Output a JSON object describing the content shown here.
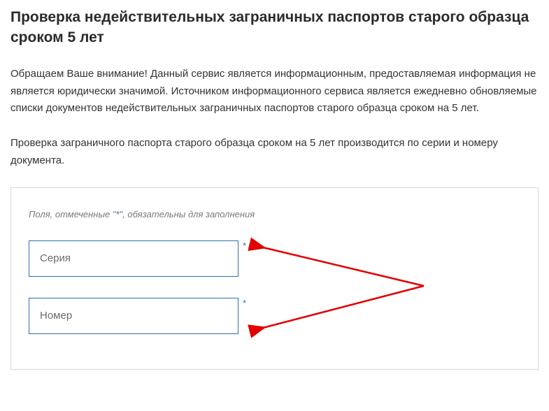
{
  "title": "Проверка недействительных заграничных паспортов старого образца сроком 5 лет",
  "paragraphs": {
    "p1": "Обращаем Ваше внимание! Данный сервис является информационным, предоставляемая информация не является юридически значимой. Источником информационного сервиса является ежедневно обновляемые списки документов недействительных заграничных паспортов старого образца сроком на 5 лет.",
    "p2": "Проверка заграничного паспорта старого образца сроком на 5 лет производится по серии и номеру документа."
  },
  "form": {
    "hint_prefix": "Поля, отмеченные \"",
    "hint_mid": "*",
    "hint_suffix": "\", обязательны для заполнения",
    "series_placeholder": "Серия",
    "number_placeholder": "Номер",
    "asterisk": "*"
  }
}
